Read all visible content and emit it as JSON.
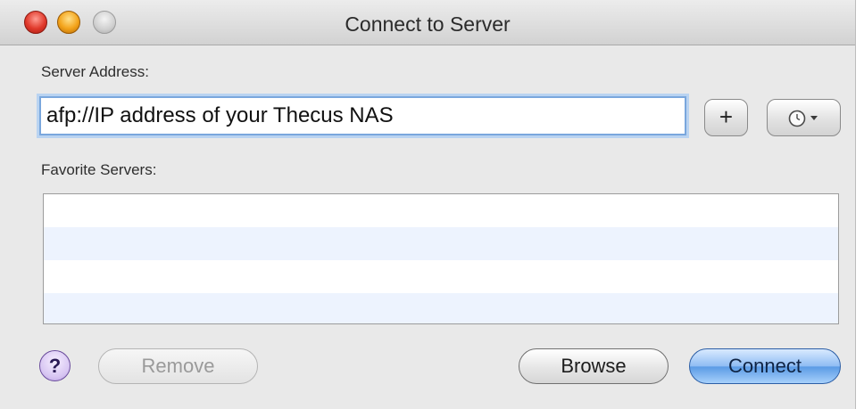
{
  "window": {
    "title": "Connect to Server"
  },
  "traffic_lights": [
    "close",
    "minimize",
    "zoom"
  ],
  "server_address": {
    "label": "Server Address:",
    "value": "afp://IP address of your Thecus NAS",
    "add_button_label": "+",
    "recent_button_icon": "clock-icon"
  },
  "favorites": {
    "label": "Favorite Servers:",
    "items": []
  },
  "buttons": {
    "help_label": "?",
    "remove_label": "Remove",
    "browse_label": "Browse",
    "connect_label": "Connect"
  },
  "colors": {
    "focus_ring": "#7aa7dd",
    "default_button": "#5b9be5",
    "list_stripe": "#edf3fe"
  }
}
